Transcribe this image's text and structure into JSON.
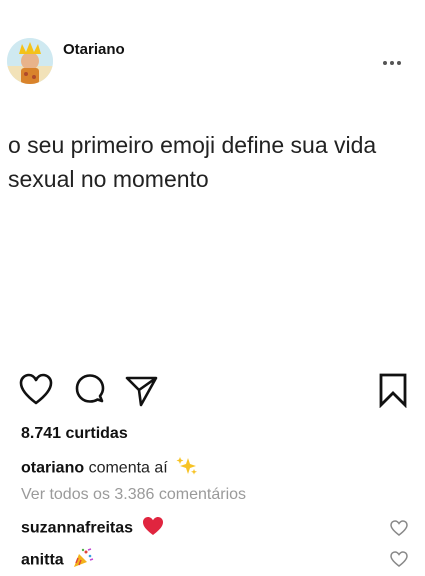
{
  "post": {
    "username": "Otariano",
    "caption": "o seu primeiro emoji define sua vida sexual no momento"
  },
  "actions": {
    "icons": [
      "heart-icon",
      "comment-icon",
      "share-icon",
      "bookmark-icon"
    ]
  },
  "stats": {
    "likes": "8.741 curtidas"
  },
  "comments": {
    "author": {
      "user": "otariano",
      "text": "comenta aí",
      "emoji": "sparkles-icon"
    },
    "view_all": "Ver todos os 3.386 comentários",
    "items": [
      {
        "user": "suzannafreitas",
        "emoji": "red-heart-icon"
      },
      {
        "user": "anitta",
        "emoji": "party-popper-icon"
      }
    ]
  },
  "colors": {
    "text": "#111111",
    "muted": "#9a9a9a",
    "heart_red": "#e0253f",
    "background": "#ffffff"
  }
}
